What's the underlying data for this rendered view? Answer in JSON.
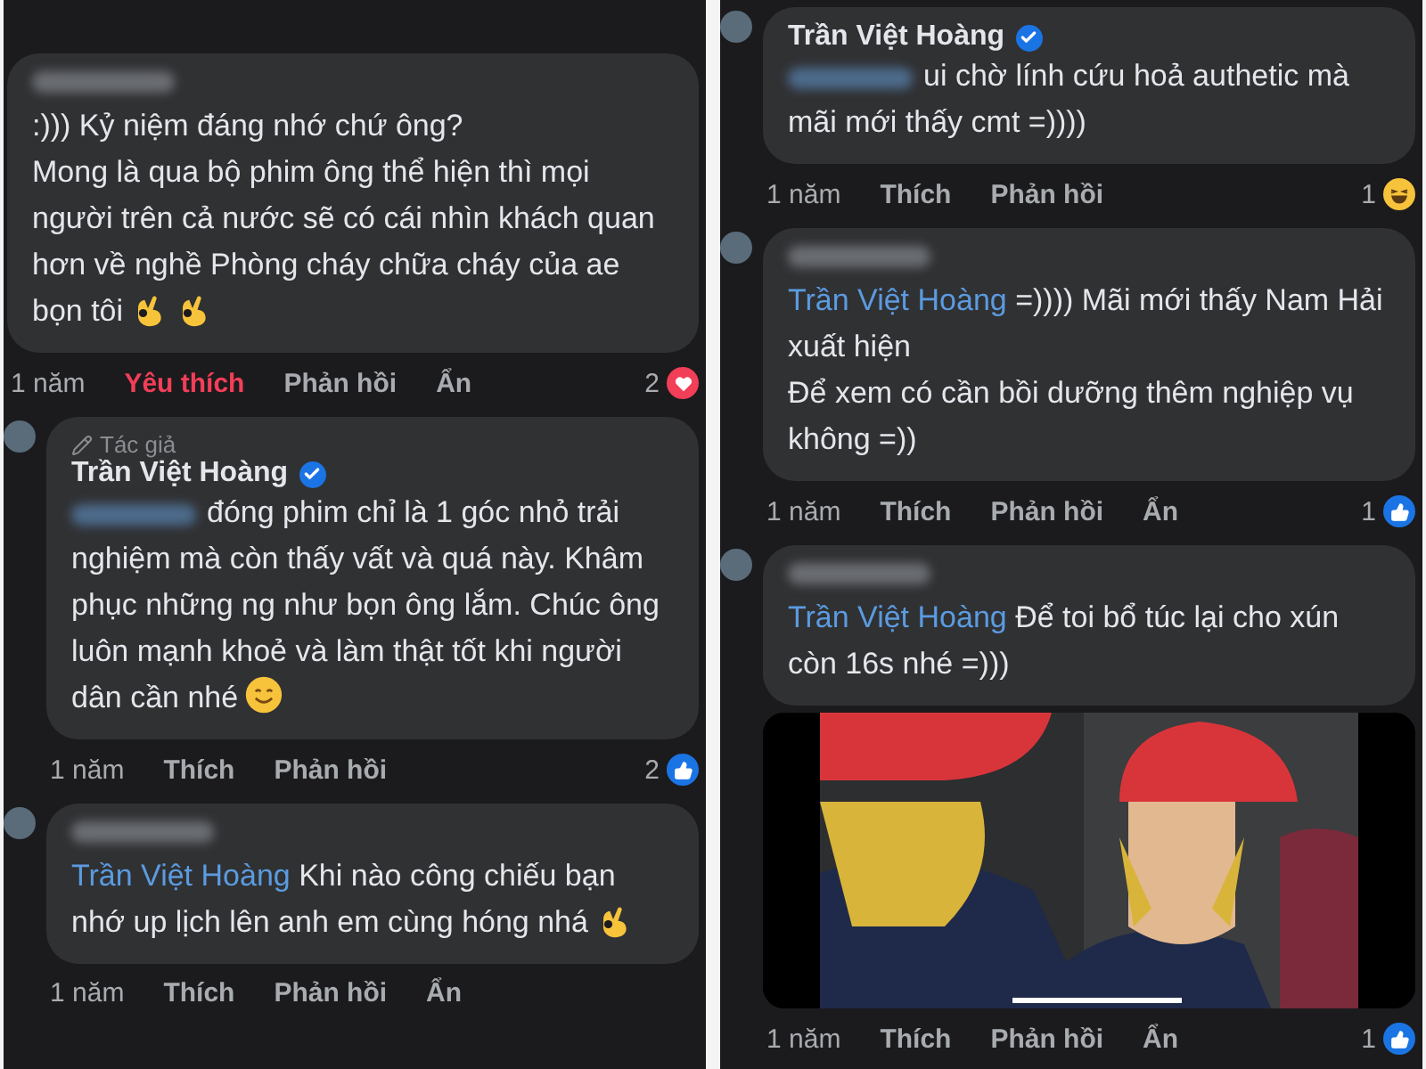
{
  "panels": [
    {
      "comments": [
        {
          "nested": false,
          "name_hidden": true,
          "text": ":))) Kỷ niệm đáng nhớ chứ ông?\nMong là qua bộ phim ông thể hiện thì mọi người trên cả nước sẽ có cái nhìn khách quan hơn về nghề Phòng cháy chữa cháy của ae bọn tôi",
          "emojis": [
            {
              "kind": "ok-hand"
            },
            {
              "kind": "ok-hand"
            }
          ],
          "time": "1 năm",
          "like": "Yêu thích",
          "liked": true,
          "reply": "Phản hồi",
          "hide": "Ẩn",
          "reaction_count": "2",
          "reaction": {
            "kind": "love"
          }
        },
        {
          "nested": true,
          "badge": "Tác giả",
          "author": "Trần Việt Hoàng",
          "verified": true,
          "prefix_hidden": true,
          "text": "đóng phim chỉ là 1 góc nhỏ trải nghiệm mà còn thấy vất và quá này. Khâm phục những ng như bọn ông lắm. Chúc ông luôn mạnh khoẻ và làm thật tốt khi người dân cần nhé",
          "emojis": [
            {
              "kind": "smile"
            }
          ],
          "time": "1 năm",
          "like": "Thích",
          "liked": false,
          "reply": "Phản hồi",
          "reaction_count": "2",
          "reaction": {
            "kind": "like"
          }
        },
        {
          "nested": true,
          "name_hidden": true,
          "mention": "Trần Việt Hoàng",
          "text": "Khi nào công chiếu bạn nhớ up lịch lên anh em cùng hóng nhá",
          "emojis": [
            {
              "kind": "ok-hand"
            }
          ],
          "time": "1 năm",
          "like": "Thích",
          "liked": false,
          "reply": "Phản hồi",
          "hide": "Ẩn"
        }
      ]
    },
    {
      "comments": [
        {
          "nested": true,
          "author": "Trần Việt Hoàng",
          "verified": true,
          "prefix_hidden": true,
          "text": "ui chờ lính cứu hoả authetic mà mãi mới thấy cmt =))))",
          "time": "1 năm",
          "like": "Thích",
          "liked": false,
          "reply": "Phản hồi",
          "reaction_count": "1",
          "reaction": {
            "kind": "haha"
          }
        },
        {
          "nested": true,
          "name_hidden": true,
          "mention": "Trần Việt Hoàng",
          "text": " =)))) Mãi mới thấy Nam Hải xuất hiện\nĐể xem có cần bồi dưỡng thêm nghiệp vụ không =))",
          "time": "1 năm",
          "like": "Thích",
          "liked": false,
          "reply": "Phản hồi",
          "hide": "Ẩn",
          "reaction_count": "1",
          "reaction": {
            "kind": "like"
          }
        },
        {
          "nested": true,
          "name_hidden": true,
          "mention": "Trần Việt Hoàng",
          "text": "Để toi bổ túc lại cho xún còn 16s nhé =)))",
          "time": "1 năm",
          "like": "Thích",
          "liked": false,
          "reply": "Phản hồi",
          "hide": "Ẩn",
          "reaction_count": "1",
          "reaction": {
            "kind": "like"
          }
        }
      ]
    }
  ]
}
